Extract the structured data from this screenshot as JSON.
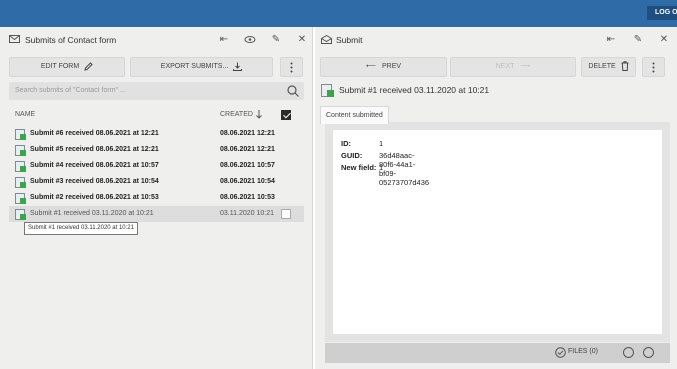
{
  "topbar": {
    "logout_label": "LOG O"
  },
  "left": {
    "title": "Submits of Contact form",
    "edit_form_label": "EDIT FORM",
    "export_label": "EXPORT SUBMITS...",
    "search_placeholder": "Search submits of \"Contact form\" ...",
    "col_name": "NAME",
    "col_created": "CREATED",
    "rows": [
      {
        "name": "Submit #6 received 08.06.2021 at 12:21",
        "created": "08.06.2021 12:21"
      },
      {
        "name": "Submit #5 received 08.06.2021 at 12:21",
        "created": "08.06.2021 12:21"
      },
      {
        "name": "Submit #4 received 08.06.2021 at 10:57",
        "created": "08.06.2021 10:57"
      },
      {
        "name": "Submit #3 received 08.06.2021 at 10:54",
        "created": "08.06.2021 10:54"
      },
      {
        "name": "Submit #2 received 08.06.2021 at 10:53",
        "created": "08.06.2021 10:53"
      },
      {
        "name": "Submit #1 received 03.11.2020 at 10:21",
        "created": "03.11.2020 10:21"
      }
    ],
    "tooltip": "Submit #1 received 03.11.2020 at 10:21"
  },
  "right": {
    "title": "Submit",
    "prev_label": "PREV",
    "next_label": "NEXT",
    "delete_label": "DELETE",
    "item_title": "Submit #1 received 03.11.2020 at 10:21",
    "tab_label": "Content submitted",
    "fields": [
      {
        "label": "ID:",
        "value": "1"
      },
      {
        "label": "GUID:",
        "value": "36d48aac-80f6-44a1-bf09-05273707d436"
      },
      {
        "label": "New field:",
        "value": "1"
      }
    ],
    "files_label": "FILES (0)"
  },
  "colors": {
    "topbar": "#2f6ba6",
    "panel": "#efefee"
  }
}
